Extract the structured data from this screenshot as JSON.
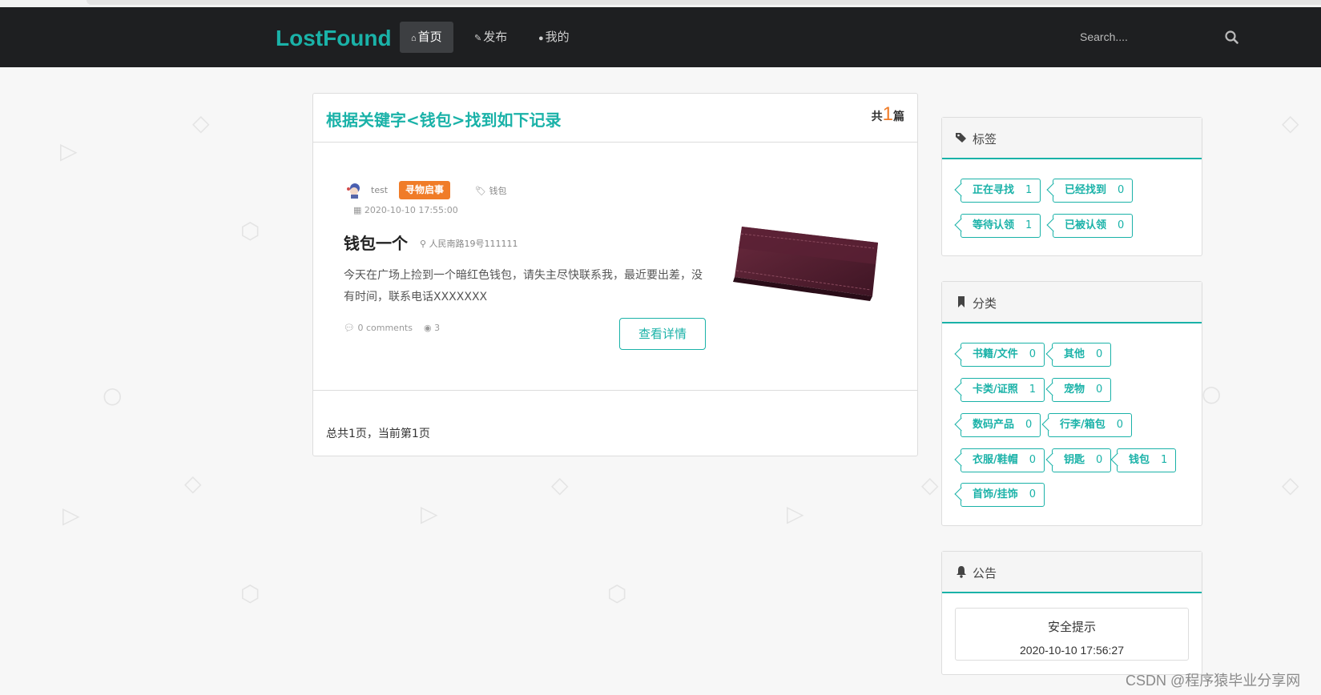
{
  "nav": {
    "brand": "LostFound",
    "items": [
      {
        "label": "首页",
        "icon": "home-icon",
        "active": true
      },
      {
        "label": "发布",
        "icon": "edit-icon",
        "active": false
      },
      {
        "label": "我的",
        "icon": "user-icon",
        "active": false
      }
    ],
    "search_placeholder": "Search...."
  },
  "results": {
    "title": "根据关键字<钱包>找到如下记录",
    "count_prefix": "共",
    "count": "1",
    "count_suffix": "篇",
    "pagination": "总共1页，当前第1页"
  },
  "post": {
    "author": "test",
    "badge": "寻物启事",
    "tag": "钱包",
    "date": "2020-10-10 17:55:00",
    "title": "钱包一个",
    "location": "人民南路19号111111",
    "body": "今天在广场上捡到一个暗红色钱包，请失主尽快联系我，最近要出差，没有时间，联系电话XXXXXXX",
    "comments": "0 comments",
    "views": "3",
    "detail_button": "查看详情",
    "image_icon": "wallet-image"
  },
  "tags_panel": {
    "title": "标签",
    "items": [
      {
        "label": "正在寻找",
        "count": "1"
      },
      {
        "label": "已经找到",
        "count": "0"
      },
      {
        "label": "等待认领",
        "count": "1"
      },
      {
        "label": "已被认领",
        "count": "0"
      }
    ]
  },
  "category_panel": {
    "title": "分类",
    "items": [
      {
        "label": "书籍/文件",
        "count": "0"
      },
      {
        "label": "其他",
        "count": "0"
      },
      {
        "label": "卡类/证照",
        "count": "1"
      },
      {
        "label": "宠物",
        "count": "0"
      },
      {
        "label": "数码产品",
        "count": "0"
      },
      {
        "label": "行李/箱包",
        "count": "0"
      },
      {
        "label": "衣服/鞋帽",
        "count": "0"
      },
      {
        "label": "钥匙",
        "count": "0"
      },
      {
        "label": "钱包",
        "count": "1"
      },
      {
        "label": "首饰/挂饰",
        "count": "0"
      }
    ]
  },
  "notice_panel": {
    "title": "公告",
    "notice_title": "安全提示",
    "notice_time": "2020-10-10 17:56:27"
  },
  "watermark": "CSDN @程序猿毕业分享网",
  "colors": {
    "accent": "#1ab2a8",
    "badge": "#f07c28",
    "navbar": "#1e1f21"
  }
}
